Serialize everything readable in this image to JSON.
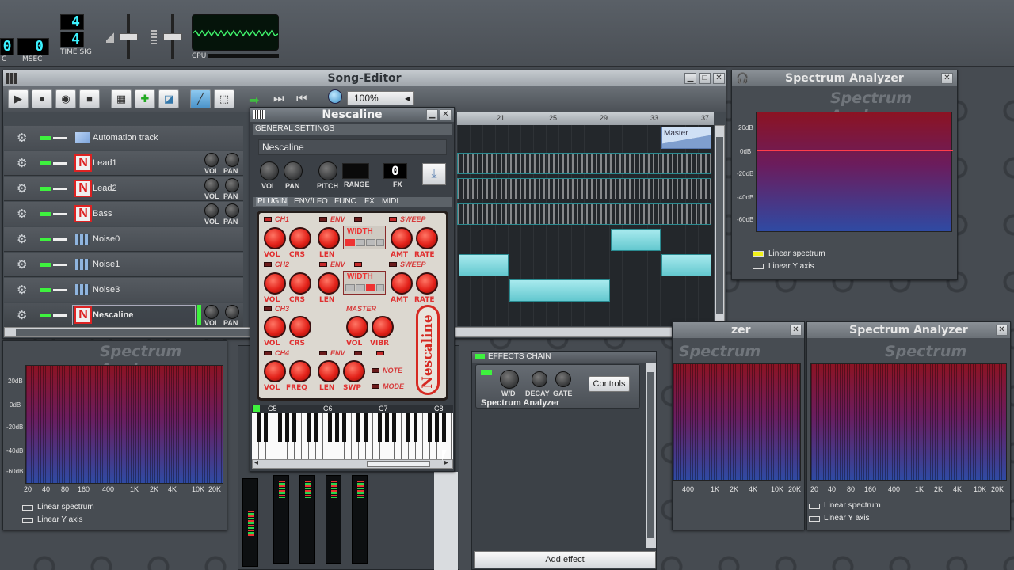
{
  "top_toolbar": {
    "time_value_left": "0",
    "time_value_msec": "0",
    "label_c": "C",
    "label_msec": "MSEC",
    "time_sig_top": "4",
    "time_sig_bottom": "4",
    "label_time_sig": "TIME SIG",
    "label_cpu": "CPU"
  },
  "song_editor": {
    "title": "Song-Editor",
    "zoom": "100%",
    "tracks": [
      {
        "name": "Automation track",
        "type": "automation"
      },
      {
        "name": "Lead1",
        "type": "instrument",
        "vol": "VOL",
        "pan": "PAN"
      },
      {
        "name": "Lead2",
        "type": "instrument",
        "vol": "VOL",
        "pan": "PAN"
      },
      {
        "name": "Bass",
        "type": "instrument",
        "vol": "VOL",
        "pan": "PAN"
      },
      {
        "name": "Noise0",
        "type": "beat"
      },
      {
        "name": "Noise1",
        "type": "beat"
      },
      {
        "name": "Noise3",
        "type": "beat"
      },
      {
        "name": "Nescaline",
        "type": "instrument",
        "vol": "VOL",
        "pan": "PAN"
      }
    ],
    "ruler": [
      "21",
      "25",
      "29",
      "33",
      "37"
    ],
    "master_clip": "Master"
  },
  "nescaline": {
    "title": "Nescaline",
    "general_settings": "GENERAL SETTINGS",
    "instrument_name": "Nescaline",
    "knob_labels": [
      "VOL",
      "PAN",
      "PITCH",
      "RANGE",
      "FX"
    ],
    "fx_value": "0",
    "tabs": [
      "PLUGIN",
      "ENV/LFO",
      "FUNC",
      "FX",
      "MIDI"
    ],
    "ch1": "CH1",
    "ch2": "CH2",
    "ch3": "CH3",
    "ch4": "CH4",
    "env": "ENV",
    "sweep": "SWEEP",
    "width": "WIDTH",
    "master": "MASTER",
    "note": "NOTE",
    "mode": "MODE",
    "logo": "Nescaline",
    "row_labels_1": [
      "VOL",
      "CRS",
      "LEN",
      "AMT",
      "RATE"
    ],
    "row_labels_3": [
      "VOL",
      "CRS",
      "VOL",
      "VIBR"
    ],
    "row_labels_4": [
      "VOL",
      "FREQ",
      "LEN",
      "SWP"
    ],
    "piano_labels": [
      "C5",
      "C6",
      "C7",
      "C8"
    ]
  },
  "effects_chain": {
    "title": "EFFECTS CHAIN",
    "effect_name": "Spectrum Analyzer",
    "knob_labels": [
      "W/D",
      "DECAY",
      "GATE"
    ],
    "controls_button": "Controls",
    "add_effect_button": "Add effect"
  },
  "spectrum_top": {
    "title": "Spectrum Analyzer",
    "bg_title": "Spectrum Analyzer",
    "y_labels": [
      "20dB",
      "0dB",
      "-20dB",
      "-40dB",
      "-60dB"
    ],
    "opt_linear_spectrum": "Linear spectrum",
    "opt_linear_y": "Linear Y axis"
  },
  "spectrum_left": {
    "bg_title": "Spectrum Analyzer",
    "y_labels": [
      "20dB",
      "0dB",
      "-20dB",
      "-40dB",
      "-60dB"
    ],
    "x_labels": [
      "20",
      "40",
      "80",
      "160",
      "400",
      "1K",
      "2K",
      "4K",
      "10K",
      "20K"
    ],
    "opt_linear_spectrum": "Linear spectrum",
    "opt_linear_y": "Linear Y axis"
  },
  "spectrum_mid": {
    "title_partial": "zer",
    "bg_title": "Spectrum Analyzer",
    "x_labels": [
      "400",
      "1K",
      "2K",
      "4K",
      "10K",
      "20K"
    ]
  },
  "spectrum_right": {
    "title": "Spectrum Analyzer",
    "bg_title": "Spectrum Analyzer",
    "x_labels": [
      "20",
      "40",
      "80",
      "160",
      "400",
      "1K",
      "2K",
      "4K",
      "10K",
      "20K"
    ],
    "opt_linear_spectrum": "Linear spectrum",
    "opt_linear_y": "Linear Y axis"
  },
  "colors": {
    "accent_cyan": "#3cf2ff",
    "clip": "#7ed6dc",
    "led_green": "#3ef23e",
    "nes_red": "#e3221a",
    "checkbox_on": "#f2f21a"
  }
}
